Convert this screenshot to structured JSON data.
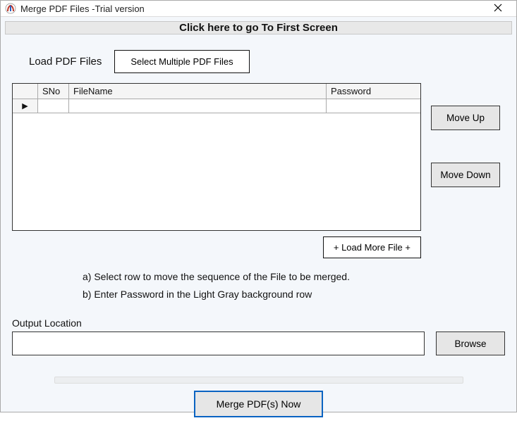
{
  "window": {
    "title": "Merge PDF Files -Trial version"
  },
  "banner": {
    "label": "Click here to go To First Screen"
  },
  "load": {
    "label": "Load PDF Files",
    "select_button": "Select Multiple PDF Files"
  },
  "grid": {
    "headers": {
      "sno": "SNo",
      "filename": "FileName",
      "password": "Password"
    },
    "rows": [
      {
        "sno": "",
        "filename": "",
        "password": ""
      }
    ]
  },
  "side": {
    "move_up": "Move Up",
    "move_down": "Move Down"
  },
  "load_more": "+ Load More File +",
  "notes": {
    "a": "a) Select row to move the sequence of the File to be merged.",
    "b": "b) Enter Password in the Light Gray background row"
  },
  "output": {
    "label": "Output Location",
    "value": "",
    "browse": "Browse"
  },
  "merge": {
    "label": "Merge  PDF(s) Now"
  }
}
